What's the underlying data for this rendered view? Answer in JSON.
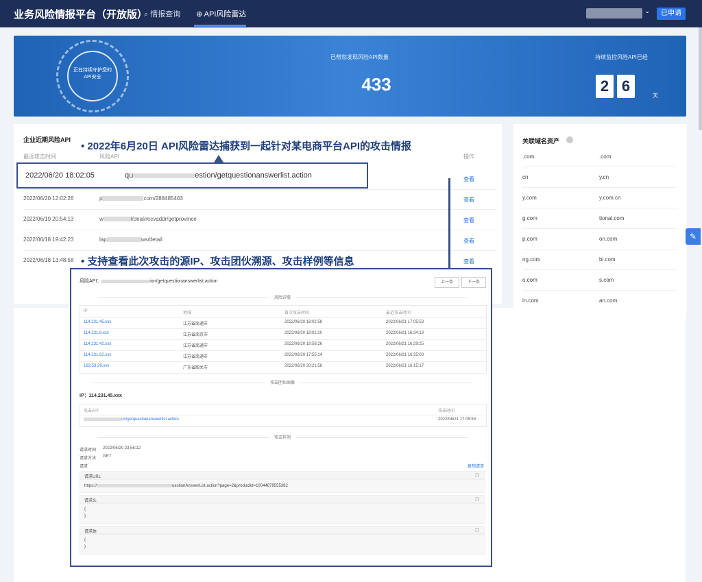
{
  "header": {
    "brand": "业务风险情报平台（开放版）",
    "nav": [
      {
        "label": "⌕ 情报查询"
      },
      {
        "label": "⊕ API风险雷达"
      }
    ],
    "chevron": "⌄",
    "apply_label": "已申请"
  },
  "hero": {
    "ring_line1": "正在持续守护您的",
    "ring_line2": "API安全",
    "found_label": "已帮您发现风险API数量",
    "found_value": "433",
    "monitor_label": "持续监控风险API已经",
    "day_digits": [
      "2",
      "6"
    ],
    "day_unit": "天"
  },
  "risk_panel": {
    "title": "企业近期风险API",
    "col_time": "最近攻击时间",
    "col_api": "风险API",
    "col_action": "操作",
    "rows": [
      {
        "time": "2022/06/20 18:02:05",
        "api": "qu",
        "api2": "estion/getquestionanswerlist.action",
        "view": "查看"
      },
      {
        "time": "2022/06/20 12:02:26",
        "api": "p",
        "api2": "com/288485403",
        "view": "查看"
      },
      {
        "time": "2022/06/19 20:54:13",
        "api": "w",
        "api2": "l/deal/recvaddr/getprovince",
        "view": "查看"
      },
      {
        "time": "2022/06/18 19:42:23",
        "api": "lap",
        "api2": "ws/detail",
        "view": "查看"
      },
      {
        "time": "2022/06/18 13:48:58",
        "api": "",
        "api2": "",
        "view": "查看"
      }
    ]
  },
  "callouts": {
    "top": "• 2022年6月20日 API风险雷达捕获到一起针对某电商平台API的攻击情报",
    "bottom": "• 支持查看此次攻击的源IP、攻击团伙溯源、攻击样例等信息"
  },
  "domains": {
    "title": "关联域名资产",
    "items": [
      ".com",
      ".com",
      "cn",
      "y.cn",
      "y.com",
      "y.com.cn",
      "g.com",
      "tional.com",
      "p.com",
      "on.com",
      "ng.com",
      "bi.com",
      "o.com",
      "s.com",
      "in.com",
      "an.com"
    ]
  },
  "detail": {
    "title_prefix": "风险API：",
    "title_api": "ion/getquestionanswerlist.action",
    "prev": "上一条",
    "next": "下一条",
    "sec_risk": "风险详情",
    "th_ip": "IP",
    "th_region": "地域",
    "th_first": "首次攻击时间",
    "th_last": "最近攻击时间",
    "ip_rows": [
      {
        "ip": "114.231.45.xxx",
        "region": "江苏省南通市",
        "first": "2022/06/20 18:02:58",
        "last": "2022/06/21 17:05:53"
      },
      {
        "ip": "114.231.8.xxx",
        "region": "江苏省南京市",
        "first": "2022/06/20 18:02:20",
        "last": "2022/06/21 16:34:19"
      },
      {
        "ip": "114.231.42.xxx",
        "region": "江苏省南通市",
        "first": "2022/06/20 19:58:26",
        "last": "2022/06/21 16:29:25"
      },
      {
        "ip": "114.231.62.xxx",
        "region": "江苏省南通市",
        "first": "2022/06/20 17:55:14",
        "last": "2022/06/21 16:25:03"
      },
      {
        "ip": "183.53.29.xxx",
        "region": "广东省韶关市",
        "first": "2022/06/20 20:21:58",
        "last": "2022/06/21 16:15:17"
      }
    ],
    "sec_gang": "攻击团伙画像",
    "gang_ip": "IP：114.231.45.xxx",
    "th_attack_api": "攻击API",
    "th_attack_time": "攻击时间",
    "gang_api": "on/getquestionanswerlist.action",
    "gang_time": "2022/06/21 17:05:53",
    "sec_sample": "攻击样例",
    "req_time_label": "请求时间",
    "req_time": "2022/06/20 23:56:12",
    "req_method_label": "请求方法",
    "req_method": "GET",
    "req_label": "请求",
    "copy_req": "复制请求",
    "url_head": "请求URL",
    "url_value": "https://",
    "url_value2": "uestionAnswerList.action?page=2&productid=10044879555382",
    "headers_head": "请求头",
    "body_head": "请求体",
    "brace_open": "{",
    "brace_close": "}"
  }
}
